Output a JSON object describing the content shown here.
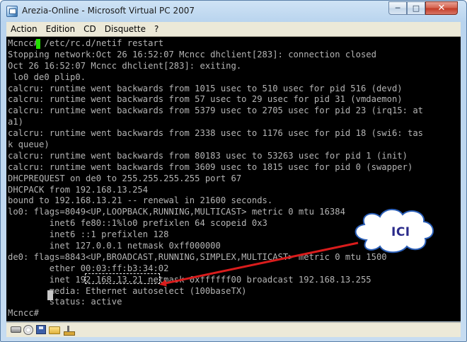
{
  "window": {
    "title": "Arezia-Online - Microsoft Virtual PC 2007",
    "minimize_glyph": "─",
    "maximize_glyph": "□",
    "close_glyph": "✕"
  },
  "menu": {
    "items": [
      "Action",
      "Edition",
      "CD",
      "Disquette",
      "?"
    ]
  },
  "terminal": {
    "lines": [
      "Mcncc# /etc/rc.d/netif restart",
      "Stopping network:Oct 26 16:52:07 Mcncc dhclient[283]: connection closed",
      "Oct 26 16:52:07 Mcncc dhclient[283]: exiting.",
      " lo0 de0 plip0.",
      "calcru: runtime went backwards from 1015 usec to 510 usec for pid 516 (devd)",
      "calcru: runtime went backwards from 57 usec to 29 usec for pid 31 (vmdaemon)",
      "calcru: runtime went backwards from 5379 usec to 2705 usec for pid 23 (irq15: at",
      "a1)",
      "calcru: runtime went backwards from 2338 usec to 1176 usec for pid 18 (swi6: tas",
      "k queue)",
      "calcru: runtime went backwards from 80183 usec to 53263 usec for pid 1 (init)",
      "calcru: runtime went backwards from 3609 usec to 1815 usec for pid 0 (swapper)",
      "DHCPREQUEST on de0 to 255.255.255.255 port 67",
      "DHCPACK from 192.168.13.254",
      "bound to 192.168.13.21 -- renewal in 21600 seconds.",
      "lo0: flags=8049<UP,LOOPBACK,RUNNING,MULTICAST> metric 0 mtu 16384",
      "        inet6 fe80::1%lo0 prefixlen 64 scopeid 0x3",
      "        inet6 ::1 prefixlen 128",
      "        inet 127.0.0.1 netmask 0xff000000",
      "de0: flags=8843<UP,BROADCAST,RUNNING,SIMPLEX,MULTICAST> metric 0 mtu 1500",
      "        ether 00:03:ff:b3:34:02",
      "        inet 192.168.13.21 netmask 0xffffff00 broadcast 192.168.13.255",
      "        media: Ethernet autoselect (100baseTX)",
      "        status: active",
      "Mcncc# "
    ]
  },
  "annotation": {
    "label": "ICI",
    "cloud_fill": "#ffffff",
    "cloud_stroke": "#2b5fb8",
    "arrow_color": "#d91c1c"
  },
  "statusbar": {
    "icons": [
      "hard-disk-icon",
      "cd-rom-icon",
      "floppy-disk-icon",
      "shared-folder-icon",
      "network-adapter-icon"
    ]
  }
}
